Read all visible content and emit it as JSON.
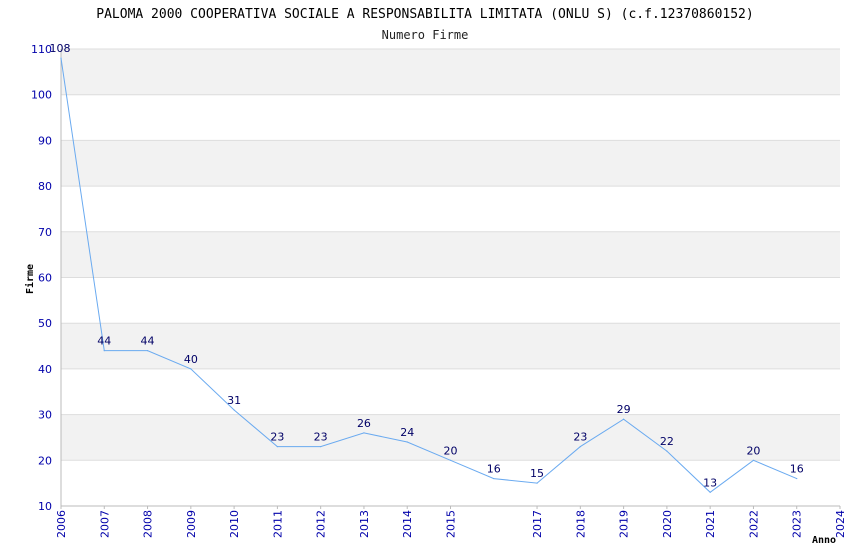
{
  "colors": {
    "line": "#6aaaf0",
    "band": "#f2f2f2",
    "grid": "#dddddd",
    "tick_text": "#0000aa",
    "label_text": "#000066"
  },
  "chart_data": {
    "type": "line",
    "title": "PALOMA 2000 COOPERATIVA SOCIALE A RESPONSABILITA LIMITATA (ONLU S) (c.f.12370860152)",
    "subtitle": "Numero Firme",
    "xlabel": "Anno",
    "ylabel": "Firme",
    "ylim": [
      10,
      110
    ],
    "yticks": [
      10,
      20,
      30,
      40,
      50,
      60,
      70,
      80,
      90,
      100,
      110
    ],
    "grid": true,
    "x": [
      "2006",
      "2007",
      "2008",
      "2009",
      "2010",
      "2011",
      "2012",
      "2013",
      "2014",
      "2015",
      "2016",
      "2017",
      "2018",
      "2019",
      "2020",
      "2021",
      "2022",
      "2023",
      "2024"
    ],
    "xticks": [
      "2006",
      "2007",
      "2008",
      "2009",
      "2010",
      "2011",
      "2012",
      "2013",
      "2014",
      "2015",
      "2017",
      "2018",
      "2019",
      "2020",
      "2021",
      "2022",
      "2023",
      "2024"
    ],
    "series": [
      {
        "values": [
          108,
          44,
          44,
          40,
          31,
          23,
          23,
          26,
          24,
          20,
          16,
          15,
          23,
          29,
          22,
          13,
          20,
          16
        ]
      }
    ]
  }
}
